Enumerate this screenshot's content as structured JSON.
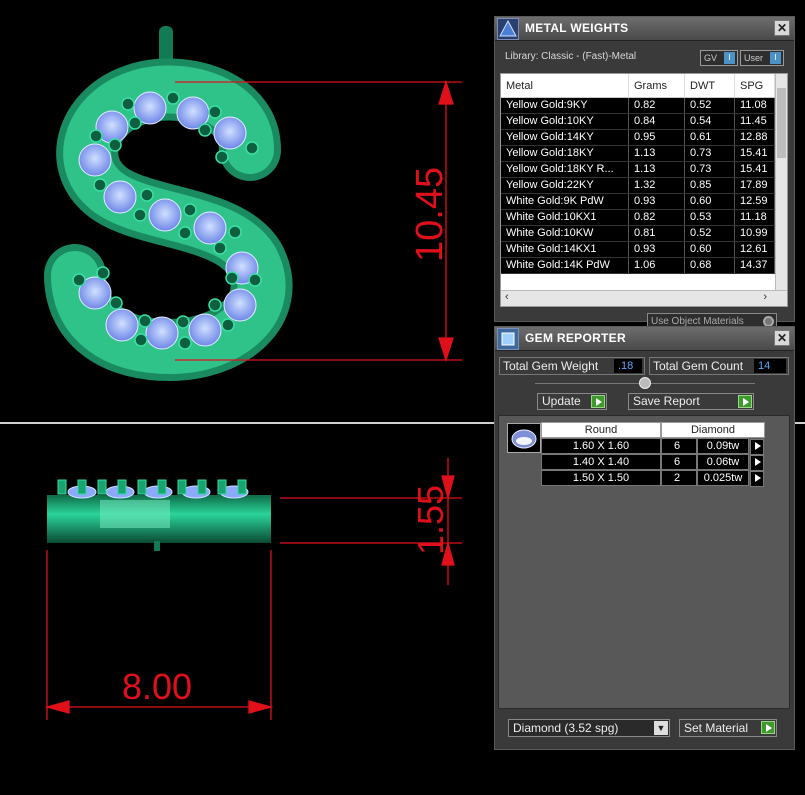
{
  "viewport": {
    "dims": [
      "10.45",
      "1.55",
      "8.00"
    ],
    "colors": {
      "model": "#1fa576",
      "gem": "#8ea8ff",
      "dim": "#e0101a"
    }
  },
  "metal_weights": {
    "title": "METAL WEIGHTS",
    "library": "Library: Classic - (Fast)-Metal",
    "toggle_gv": "GV",
    "toggle_user": "User",
    "columns": [
      "Metal",
      "Grams",
      "DWT",
      "SPG"
    ],
    "rows": [
      [
        "Yellow Gold:9KY",
        "0.82",
        "0.52",
        "11.08"
      ],
      [
        "Yellow Gold:10KY",
        "0.84",
        "0.54",
        "11.45"
      ],
      [
        "Yellow Gold:14KY",
        "0.95",
        "0.61",
        "12.88"
      ],
      [
        "Yellow Gold:18KY",
        "1.13",
        "0.73",
        "15.41"
      ],
      [
        "Yellow Gold:18KY R...",
        "1.13",
        "0.73",
        "15.41"
      ],
      [
        "Yellow Gold:22KY",
        "1.32",
        "0.85",
        "17.89"
      ],
      [
        "White Gold:9K PdW",
        "0.93",
        "0.60",
        "12.59"
      ],
      [
        "White Gold:10KX1",
        "0.82",
        "0.53",
        "11.18"
      ],
      [
        "White Gold:10KW",
        "0.81",
        "0.52",
        "10.99"
      ],
      [
        "White Gold:14KX1",
        "0.93",
        "0.60",
        "12.61"
      ],
      [
        "White Gold:14K PdW",
        "1.06",
        "0.68",
        "14.37"
      ]
    ],
    "use_object_materials": "Use Object Materials"
  },
  "gem_reporter": {
    "title": "GEM REPORTER",
    "total_weight_label": "Total Gem Weight",
    "total_weight_value": ".18",
    "total_count_label": "Total Gem Count",
    "total_count_value": "14",
    "update_label": "Update",
    "save_report_label": "Save Report",
    "shape": "Round",
    "material": "Diamond",
    "gems": [
      [
        "1.60 X 1.60",
        "6",
        "0.09tw"
      ],
      [
        "1.40 X 1.40",
        "6",
        "0.06tw"
      ],
      [
        "1.50 X 1.50",
        "2",
        "0.025tw"
      ]
    ],
    "material_select": "Diamond    (3.52 spg)",
    "set_material_label": "Set Material"
  }
}
